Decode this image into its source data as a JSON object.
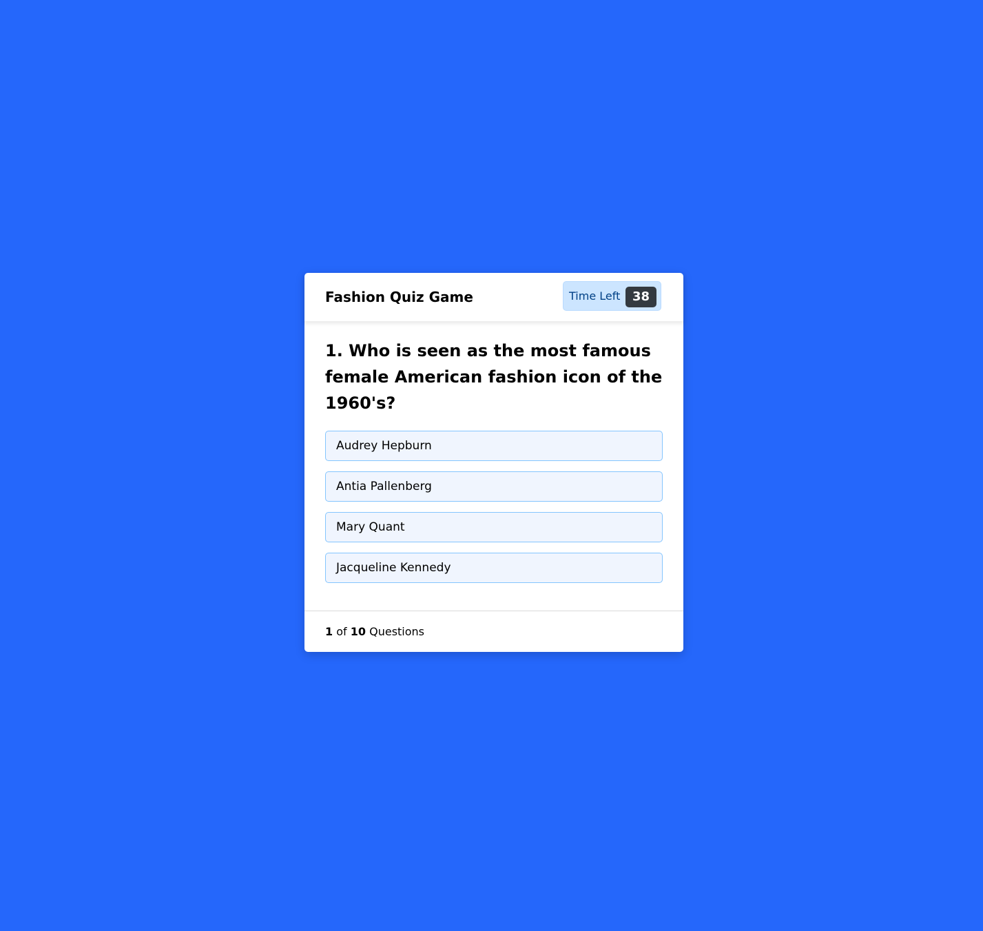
{
  "app": {
    "title": "Fashion Quiz Game"
  },
  "timer": {
    "label": "Time Left",
    "seconds": "38"
  },
  "question": {
    "text": "1. Who is seen as the most famous female American fashion icon of the 1960's?",
    "options": [
      {
        "label": "Audrey Hepburn"
      },
      {
        "label": "Antia Pallenberg"
      },
      {
        "label": "Mary Quant"
      },
      {
        "label": "Jacqueline Kennedy"
      }
    ]
  },
  "footer": {
    "current": "1",
    "of_text": "of",
    "total": "10",
    "suffix": "Questions"
  },
  "colors": {
    "background": "#2567fb",
    "option_bg": "#f0f5fe",
    "option_border": "#84c5fe",
    "timer_bg": "#cce5ff",
    "timer_badge": "#343a40"
  }
}
